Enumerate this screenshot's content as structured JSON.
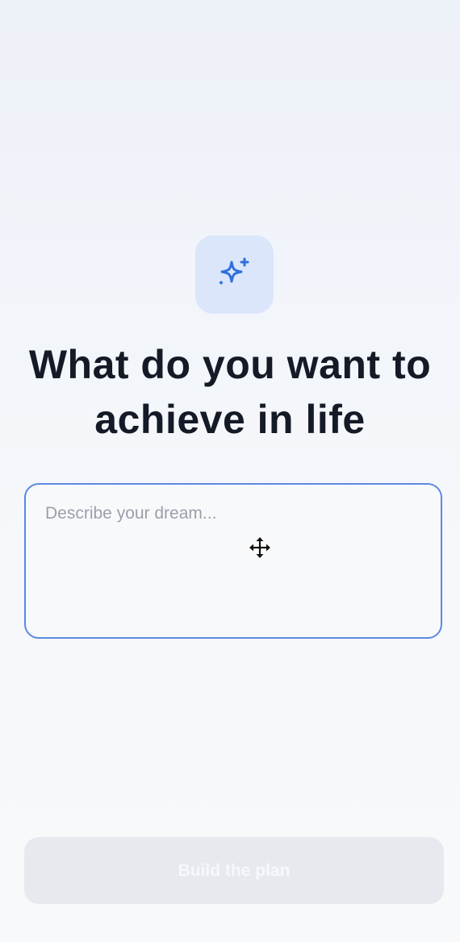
{
  "header": {
    "icon": "sparkles-icon",
    "title": "What do you want to achieve in life"
  },
  "dream_input": {
    "value": "",
    "placeholder": "Describe your dream..."
  },
  "cursor": {
    "icon": "move-cursor-icon"
  },
  "actions": {
    "build_label": "Build the plan"
  },
  "colors": {
    "accent": "#2f6fdc",
    "icon_tile_bg": "#dbe6fb",
    "input_border": "#5a8ae0",
    "title_text": "#141a26",
    "button_disabled_bg": "#e7e9ee"
  }
}
